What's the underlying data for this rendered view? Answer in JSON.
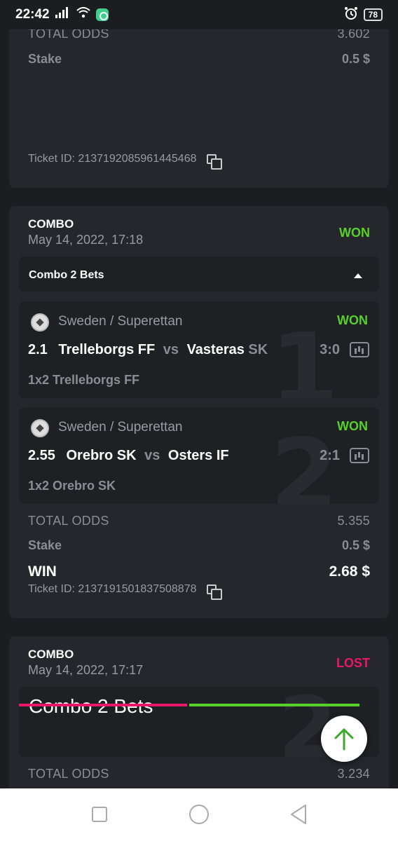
{
  "status_bar": {
    "time": "22:42",
    "battery": "78"
  },
  "ticket1": {
    "total_odds_label": "TOTAL ODDS",
    "total_odds": "3.602",
    "stake_label": "Stake",
    "stake": "0.5 $",
    "ticket_id": "Ticket ID: 2137192085961445468"
  },
  "ticket2": {
    "type": "COMBO",
    "date": "May 14, 2022, 17:18",
    "status": "WON",
    "combo_label": "Combo 2 Bets",
    "events": [
      {
        "number": "1",
        "league": "Sweden / Superettan",
        "status": "WON",
        "odd": "2.1",
        "home": "Trelleborgs FF",
        "vs": "vs",
        "away_main": "Vasteras",
        "away_suffix": "SK",
        "score": "3:0",
        "pick": "1x2 Trelleborgs FF"
      },
      {
        "number": "2",
        "league": "Sweden / Superettan",
        "status": "WON",
        "odd": "2.55",
        "home": "Orebro SK",
        "vs": "vs",
        "away_main": "Osters IF",
        "away_suffix": "",
        "score": "2:1",
        "pick": "1x2 Orebro SK"
      }
    ],
    "total_odds_label": "TOTAL ODDS",
    "total_odds": "5.355",
    "stake_label": "Stake",
    "stake": "0.5 $",
    "win_label": "WIN",
    "win": "2.68 $",
    "ticket_id": "Ticket ID: 2137191501837508878"
  },
  "ticket3": {
    "type": "COMBO",
    "date": "May 14, 2022, 17:17",
    "status": "LOST",
    "combo_label": "Combo 2 Bets",
    "number": "2",
    "total_odds_label": "TOTAL ODDS",
    "total_odds": "3.234"
  },
  "colors": {
    "won": "#57d12a",
    "lost": "#e8176a",
    "card": "#26272c",
    "background": "#1c1d21"
  }
}
